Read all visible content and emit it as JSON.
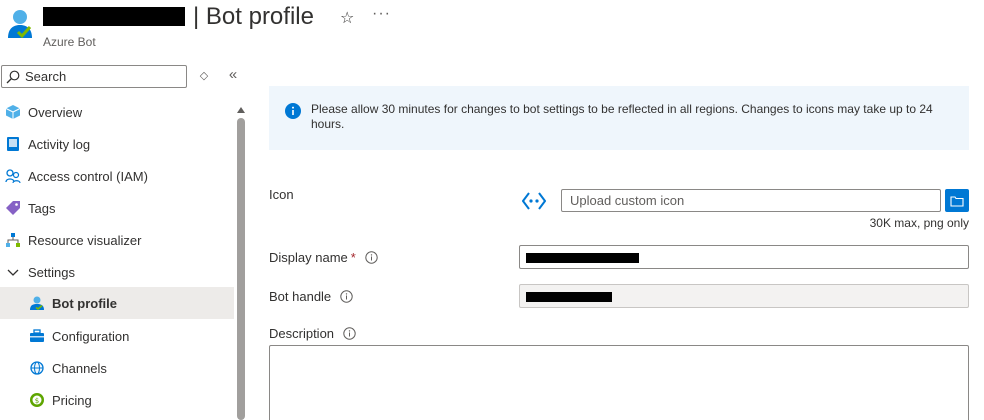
{
  "header": {
    "title": "| Bot profile",
    "subtitle": "Azure Bot",
    "more_label": "···"
  },
  "search": {
    "placeholder": "Search"
  },
  "sidebar": {
    "items": [
      {
        "label": "Overview",
        "icon": "cube-icon"
      },
      {
        "label": "Activity log",
        "icon": "log-icon"
      },
      {
        "label": "Access control (IAM)",
        "icon": "people-icon"
      },
      {
        "label": "Tags",
        "icon": "tag-icon"
      },
      {
        "label": "Resource visualizer",
        "icon": "hierarchy-icon"
      },
      {
        "label": "Settings",
        "icon": "chevron-down-icon"
      },
      {
        "label": "Bot profile",
        "icon": "bot-icon",
        "selected": true
      },
      {
        "label": "Configuration",
        "icon": "toolbox-icon"
      },
      {
        "label": "Channels",
        "icon": "globe-icon"
      },
      {
        "label": "Pricing",
        "icon": "pricing-icon"
      }
    ]
  },
  "banner": {
    "text": "Please allow 30 minutes for changes to bot settings to be reflected in all regions. Changes to icons may take up to 24 hours."
  },
  "form": {
    "icon_label": "Icon",
    "upload_placeholder": "Upload custom icon",
    "upload_hint": "30K max, png only",
    "display_name_label": "Display name",
    "required_marker": "*",
    "bot_handle_label": "Bot handle",
    "description_label": "Description"
  },
  "colors": {
    "accent": "#0078d4",
    "banner_bg": "#eff6fc",
    "selected_bg": "#edebe9",
    "required": "#a4262c"
  }
}
